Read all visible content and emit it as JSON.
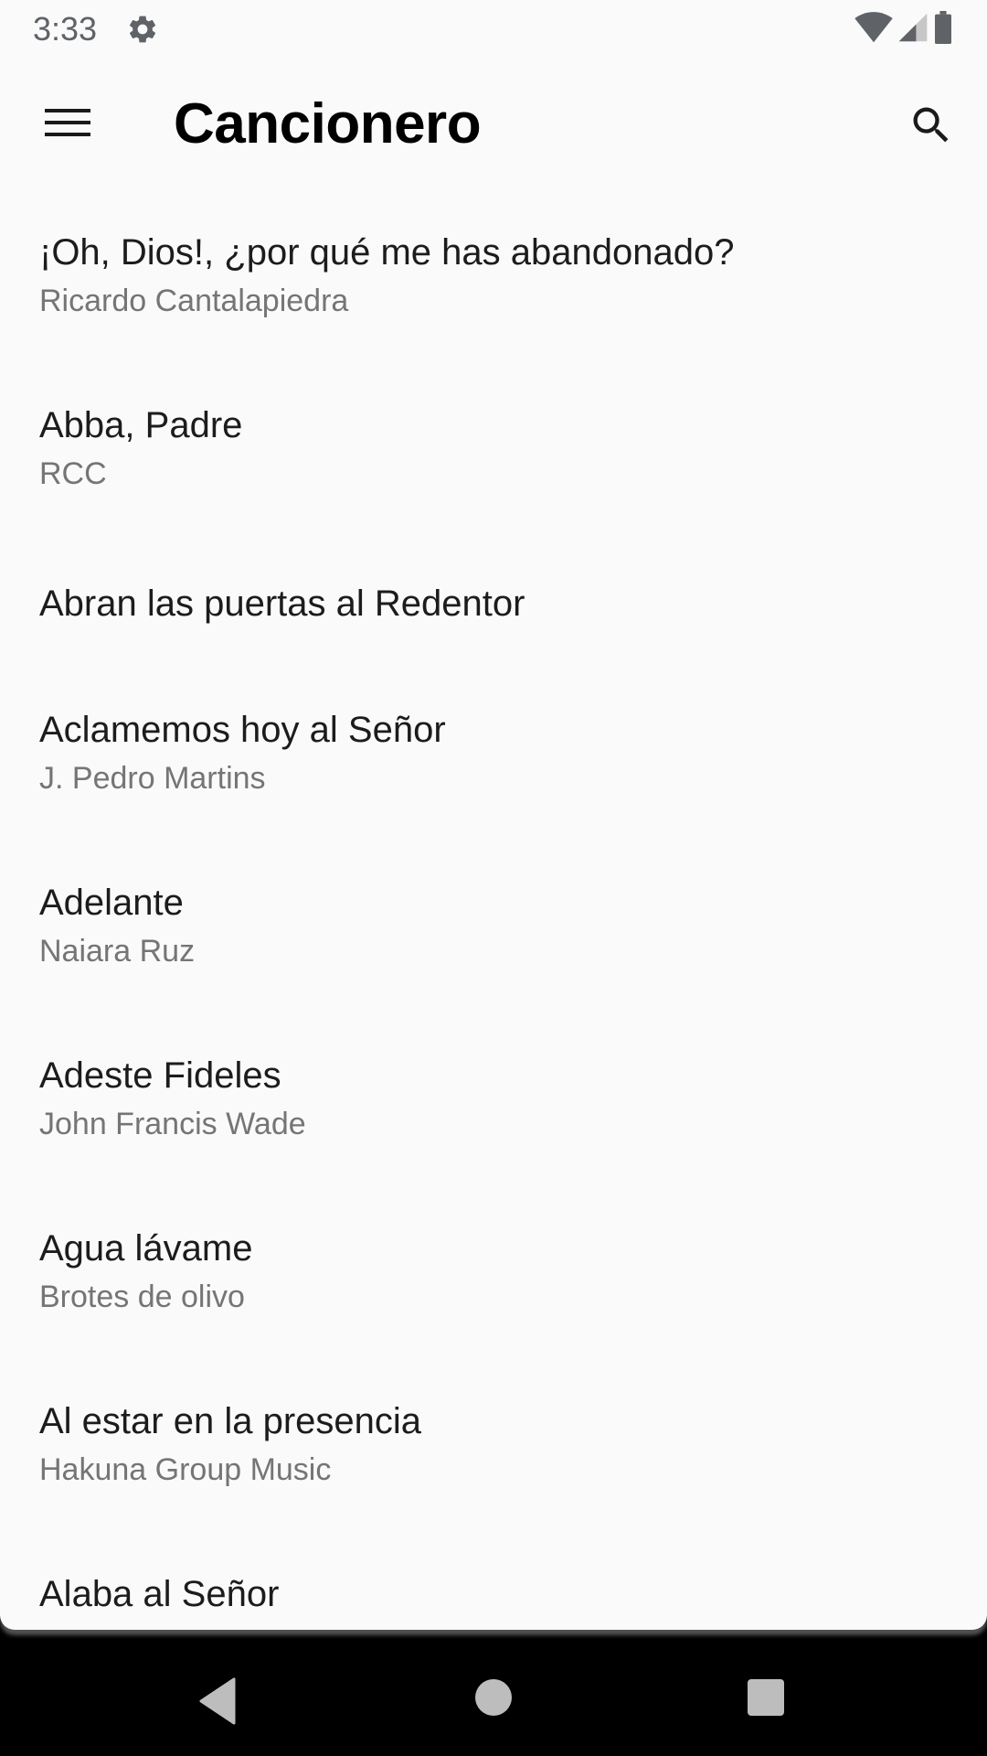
{
  "status_bar": {
    "time": "3:33",
    "settings_icon": "gear-icon",
    "wifi_icon": "wifi-icon",
    "signal_icon": "cell-signal-icon",
    "battery_icon": "battery-icon"
  },
  "app_bar": {
    "title": "Cancionero",
    "menu_icon": "hamburger-menu-icon",
    "search_icon": "search-icon"
  },
  "songs": [
    {
      "title": "¡Oh, Dios!, ¿por qué me has abandonado?",
      "author": "Ricardo Cantalapiedra"
    },
    {
      "title": "Abba, Padre",
      "author": "RCC"
    },
    {
      "title": "Abran las puertas al Redentor",
      "author": ""
    },
    {
      "title": "Aclamemos hoy al Señor",
      "author": "J. Pedro Martins"
    },
    {
      "title": "Adelante",
      "author": "Naiara Ruz"
    },
    {
      "title": "Adeste Fideles",
      "author": "John Francis Wade"
    },
    {
      "title": "Agua lávame",
      "author": "Brotes de olivo"
    },
    {
      "title": "Al estar en la presencia",
      "author": "Hakuna Group Music"
    },
    {
      "title": "Alaba al Señor",
      "author": ""
    }
  ],
  "nav_bar": {
    "back_icon": "back-triangle-icon",
    "home_icon": "home-circle-icon",
    "recents_icon": "recents-square-icon"
  },
  "colors": {
    "background": "#fafafa",
    "title_text": "#1c1c1c",
    "subtitle_text": "#757575",
    "nav_background": "#000000"
  }
}
